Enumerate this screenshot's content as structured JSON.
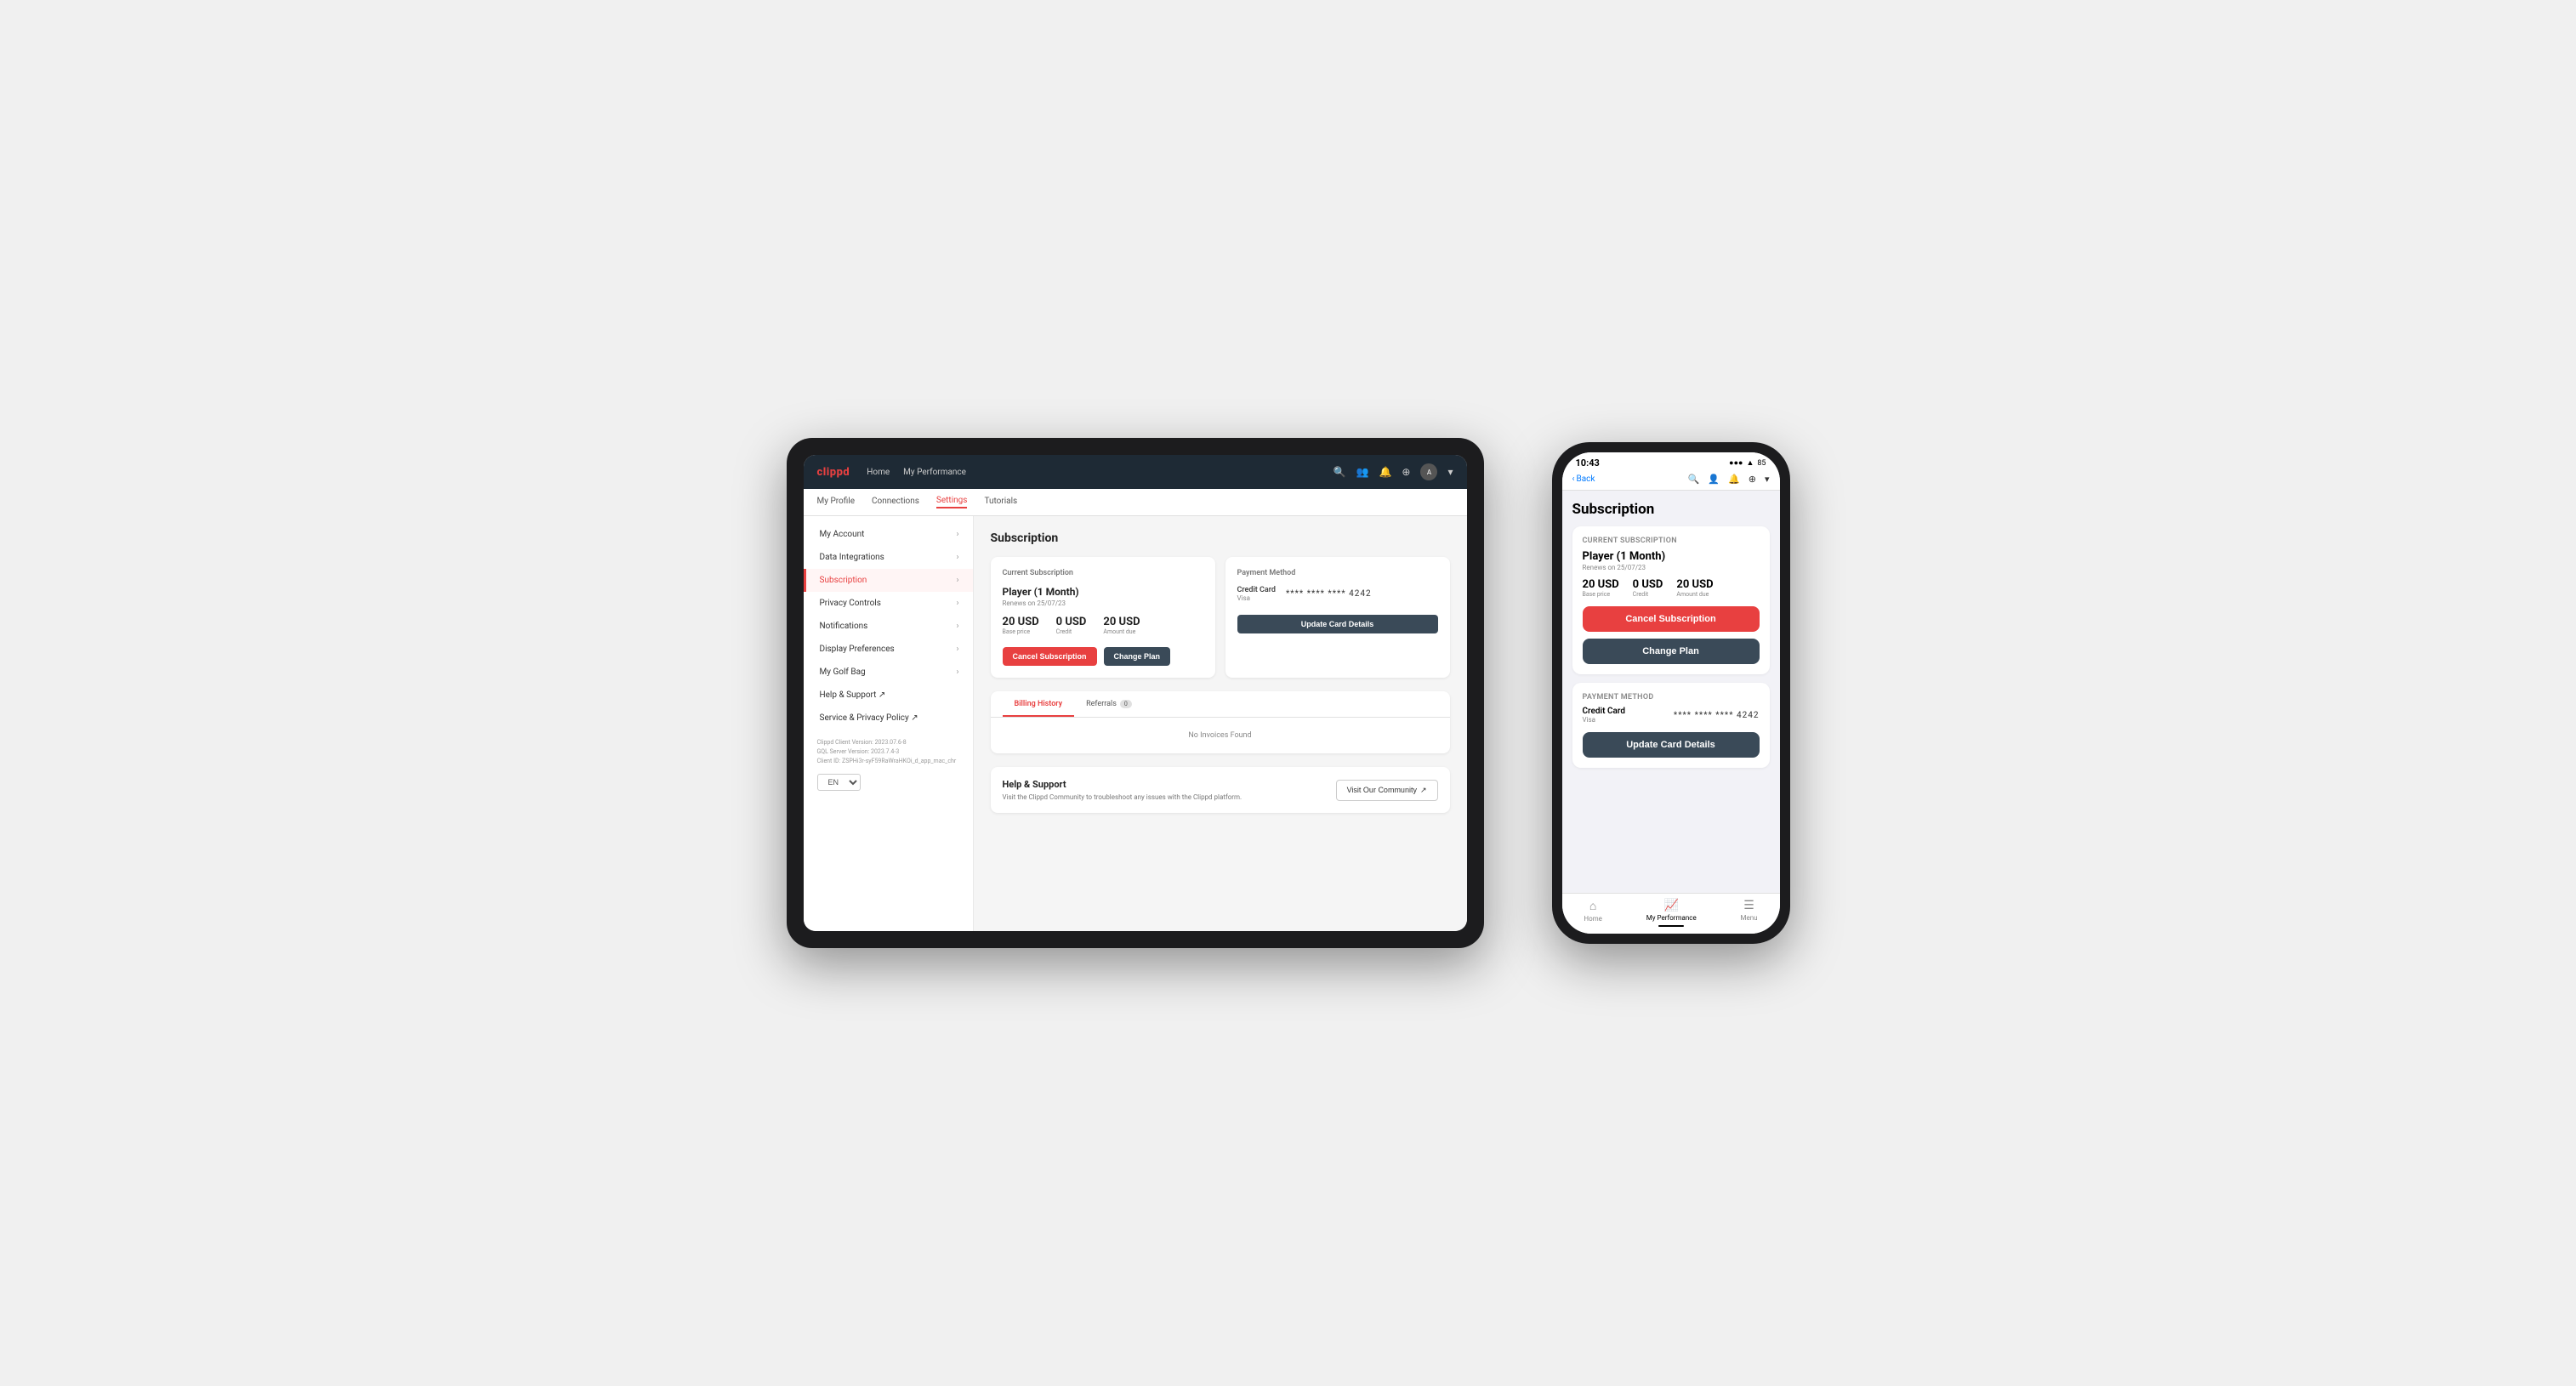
{
  "tablet": {
    "nav": {
      "logo": "clippd",
      "links": [
        "Home",
        "My Performance"
      ],
      "icons": [
        "🔍",
        "👥",
        "🔔",
        "⊕",
        "A"
      ]
    },
    "subnav": {
      "items": [
        "My Profile",
        "Connections",
        "Settings",
        "Tutorials"
      ],
      "active": "Settings"
    },
    "sidebar": {
      "items": [
        {
          "label": "My Account",
          "active": false
        },
        {
          "label": "Data Integrations",
          "active": false
        },
        {
          "label": "Subscription",
          "active": true
        },
        {
          "label": "Privacy Controls",
          "active": false
        },
        {
          "label": "Notifications",
          "active": false
        },
        {
          "label": "Display Preferences",
          "active": false
        },
        {
          "label": "My Golf Bag",
          "active": false
        },
        {
          "label": "Help & Support",
          "active": false
        },
        {
          "label": "Service & Privacy Policy",
          "active": false
        }
      ],
      "footer": {
        "version_line1": "Clippd Client Version: 2023.07.6-8",
        "version_line2": "GQL Server Version: 2023.7.4-3",
        "version_line3": "Client ID: ZSPHi3r-syF59RaWraHKOi_d_app_mac_chr"
      },
      "lang": "EN"
    },
    "main": {
      "title": "Subscription",
      "current_subscription": {
        "label": "Current Subscription",
        "plan_name": "Player (1 Month)",
        "renew_text": "Renews on 25/07/23",
        "base_price": "20 USD",
        "base_label": "Base price",
        "credit": "0 USD",
        "credit_label": "Credit",
        "amount_due": "20 USD",
        "amount_label": "Amount due",
        "cancel_btn": "Cancel Subscription",
        "change_btn": "Change Plan"
      },
      "payment_method": {
        "label": "Payment Method",
        "type": "Credit Card",
        "brand": "Visa",
        "number": "**** **** **** 4242",
        "update_btn": "Update Card Details"
      },
      "billing": {
        "tabs": [
          {
            "label": "Billing History",
            "active": true,
            "badge": null
          },
          {
            "label": "Referrals",
            "active": false,
            "badge": "0"
          }
        ],
        "empty_text": "No Invoices Found"
      },
      "help": {
        "title": "Help & Support",
        "description": "Visit the Clippd Community to troubleshoot any issues with the Clippd platform.",
        "community_btn": "Visit Our Community"
      }
    }
  },
  "phone": {
    "status_bar": {
      "time": "10:43",
      "signal": "●●●",
      "wifi": "WiFi",
      "battery": "85"
    },
    "nav": {
      "back": "Back",
      "icons": [
        "🔍",
        "👤",
        "🔔",
        "⊕"
      ]
    },
    "content": {
      "title": "Subscription",
      "current_subscription": {
        "label": "Current Subscription",
        "plan_name": "Player (1 Month)",
        "renew_text": "Renews on 25/07/23",
        "base_price": "20 USD",
        "base_label": "Base price",
        "credit": "0 USD",
        "credit_label": "Credit",
        "amount_due": "20 USD",
        "amount_label": "Amount due",
        "cancel_btn": "Cancel Subscription",
        "change_btn": "Change Plan"
      },
      "payment_method": {
        "label": "Payment Method",
        "type": "Credit Card",
        "brand": "Visa",
        "number": "**** **** **** 4242",
        "update_btn": "Update Card Details"
      }
    },
    "tab_bar": {
      "items": [
        {
          "label": "Home",
          "icon": "⌂",
          "active": false
        },
        {
          "label": "My Performance",
          "icon": "📈",
          "active": true
        },
        {
          "label": "Menu",
          "icon": "☰",
          "active": false
        }
      ]
    }
  }
}
